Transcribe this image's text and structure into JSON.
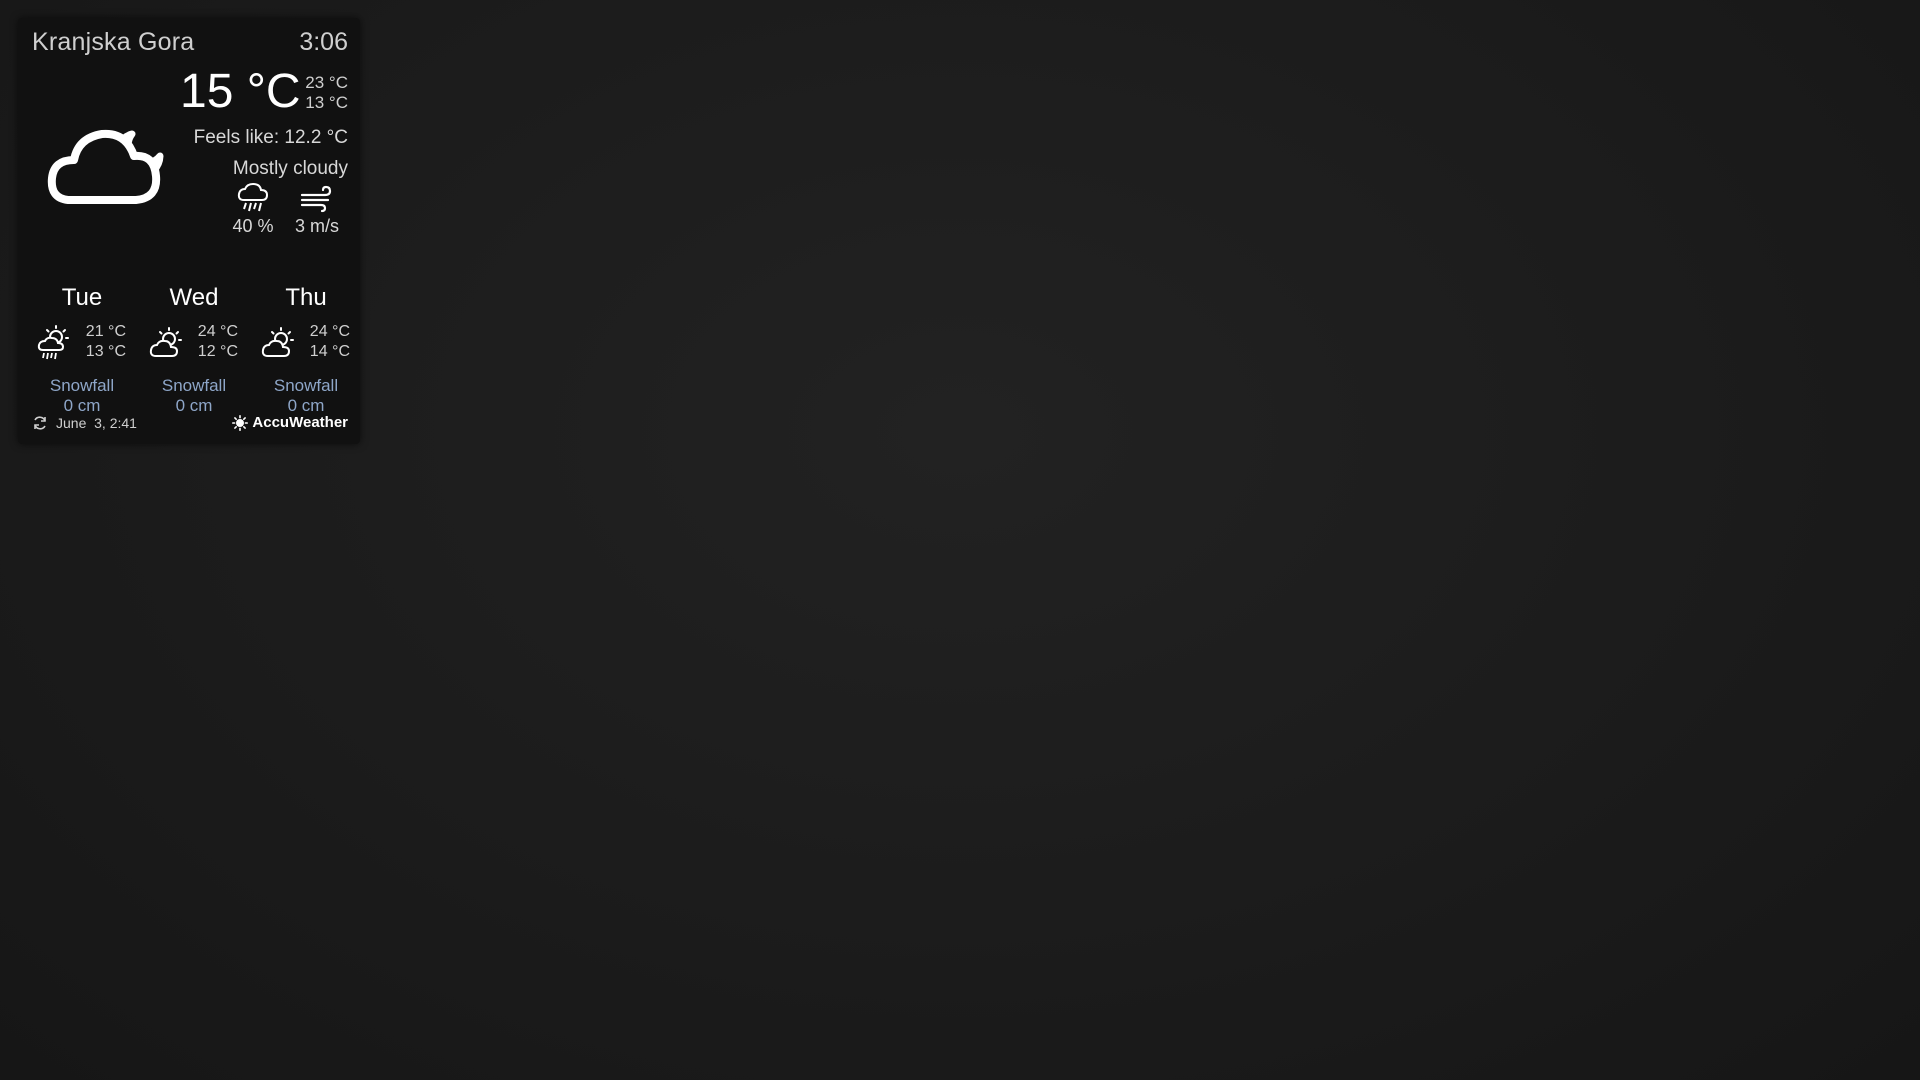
{
  "widget": {
    "location": "Kranjska Gora",
    "time": "3:06",
    "current": {
      "icon": "cloud-moon-icon",
      "temperature": "15 °C",
      "high": "23 °C",
      "low": "13 °C",
      "feels_like": "Feels like: 12.2 °C",
      "condition": "Mostly cloudy",
      "precip_icon": "rain-cloud-icon",
      "precip_value": "40 %",
      "wind_icon": "wind-icon",
      "wind_value": "3 m/s"
    },
    "forecast": [
      {
        "day": "Tue",
        "icon": "sun-cloud-rain-icon",
        "high": "21 °C",
        "low": "13 °C",
        "snow_label": "Snowfall",
        "snow_value": "0 cm"
      },
      {
        "day": "Wed",
        "icon": "sun-cloud-icon",
        "high": "24 °C",
        "low": "12 °C",
        "snow_label": "Snowfall",
        "snow_value": "0 cm"
      },
      {
        "day": "Thu",
        "icon": "sun-cloud-icon",
        "high": "24 °C",
        "low": "14 °C",
        "snow_label": "Snowfall",
        "snow_value": "0 cm"
      }
    ],
    "footer": {
      "refresh_icon": "refresh-icon",
      "updated": "June  3, 2:41",
      "brand_icon": "accuweather-sun-icon",
      "brand": "AccuWeather"
    }
  },
  "colors": {
    "background": "#1c1c1c",
    "panel": "#111111",
    "text": "#ffffff",
    "muted_text": "#cfcfcf",
    "snow_text": "#8ea6c8"
  }
}
